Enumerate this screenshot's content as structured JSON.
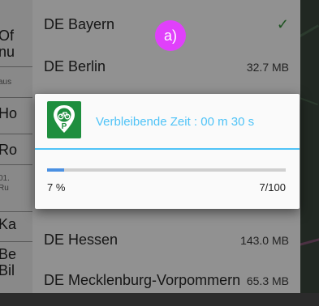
{
  "background_app": {
    "items": [
      {
        "label": "Of",
        "label2": "nu",
        "sub": "aus"
      },
      {
        "label": "Ho"
      },
      {
        "label": "Ro",
        "sub": "01.",
        "sub2": "Ru"
      },
      {
        "label": "Ka"
      },
      {
        "label": "Be",
        "label2": "Bil"
      }
    ]
  },
  "region_list": {
    "rows": [
      {
        "name": "DE Bayern",
        "size": "",
        "downloaded": true
      },
      {
        "name": "DE Berlin",
        "size": "32.7 MB"
      },
      {
        "name": "DE Hessen",
        "size": "143.0 MB"
      },
      {
        "name": "DE Mecklenburg-Vorpommern",
        "size": "65.3 MB"
      }
    ],
    "check_glyph": "✓"
  },
  "annotation": {
    "label": "a)"
  },
  "dialog": {
    "title": "Verbleibende Zeit : 00 m 30 s",
    "percent_label": "7 %",
    "count_label": "7/100",
    "progress": 0.07,
    "icon": "bike-parking-icon"
  },
  "colors": {
    "accent": "#4fc3f7",
    "progress_fill": "#4a90e2",
    "badge": "#e040fb",
    "icon_bg": "#1e8e3e",
    "check": "#2e7d32"
  }
}
